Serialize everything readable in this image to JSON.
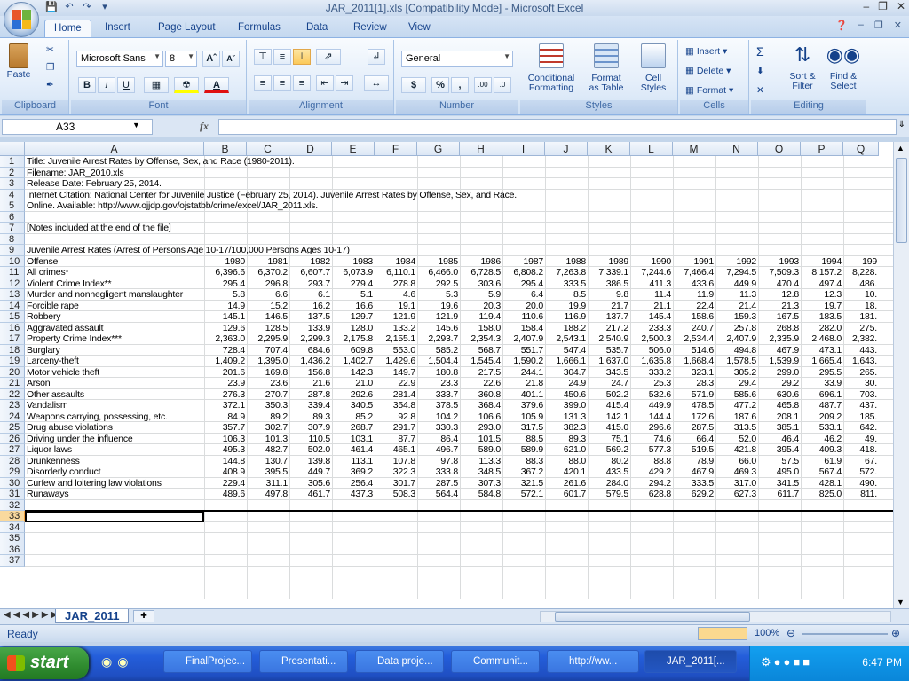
{
  "window": {
    "title": "JAR_2011[1].xls  [Compatibility Mode] - Microsoft Excel"
  },
  "ribbon_tabs": [
    "Home",
    "Insert",
    "Page Layout",
    "Formulas",
    "Data",
    "Review",
    "View"
  ],
  "ribbon": {
    "clipboard": {
      "label": "Clipboard",
      "paste": "Paste"
    },
    "font": {
      "label": "Font",
      "name": "Microsoft Sans",
      "size": "8"
    },
    "alignment": {
      "label": "Alignment"
    },
    "number": {
      "label": "Number",
      "format": "General"
    },
    "styles": {
      "label": "Styles",
      "conditional": "Conditional",
      "conditional2": "Formatting",
      "format_table": "Format",
      "format_table2": "as Table",
      "cell_styles": "Cell",
      "cell_styles2": "Styles"
    },
    "cells": {
      "label": "Cells",
      "insert": "Insert",
      "delete": "Delete",
      "format": "Format"
    },
    "editing": {
      "label": "Editing",
      "sort": "Sort &",
      "sort2": "Filter",
      "find": "Find &",
      "find2": "Select"
    }
  },
  "formula_bar": {
    "name_box": "A33",
    "fx": "fx",
    "value": ""
  },
  "columns": [
    "A",
    "B",
    "C",
    "D",
    "E",
    "F",
    "G",
    "H",
    "I",
    "J",
    "K",
    "L",
    "M",
    "N",
    "O",
    "P",
    "Q"
  ],
  "rows": [
    [
      "Title: Juvenile Arrest Rates by Offense, Sex, and Race (1980-2011)."
    ],
    [
      "Filename: JAR_2010.xls"
    ],
    [
      "Release Date: February 25, 2014."
    ],
    [
      "Internet Citation: National Center for Juvenile Justice (February 25, 2014). Juvenile Arrest Rates by Offense, Sex, and Race."
    ],
    [
      "  Online. Available: http://www.ojjdp.gov/ojstatbb/crime/excel/JAR_2011.xls."
    ],
    [
      ""
    ],
    [
      "[Notes included at the end of the file]"
    ],
    [
      ""
    ],
    [
      "Juvenile Arrest Rates (Arrest of Persons Age 10-17/100,000 Persons Ages 10-17)"
    ],
    [
      "Offense",
      "1980",
      "1981",
      "1982",
      "1983",
      "1984",
      "1985",
      "1986",
      "1987",
      "1988",
      "1989",
      "1990",
      "1991",
      "1992",
      "1993",
      "1994",
      "199"
    ],
    [
      "All crimes*",
      "6,396.6",
      "6,370.2",
      "6,607.7",
      "6,073.9",
      "6,110.1",
      "6,466.0",
      "6,728.5",
      "6,808.2",
      "7,263.8",
      "7,339.1",
      "7,244.6",
      "7,466.4",
      "7,294.5",
      "7,509.3",
      "8,157.2",
      "8,228."
    ],
    [
      "Violent Crime Index**",
      "295.4",
      "296.8",
      "293.7",
      "279.4",
      "278.8",
      "292.5",
      "303.6",
      "295.4",
      "333.5",
      "386.5",
      "411.3",
      "433.6",
      "449.9",
      "470.4",
      "497.4",
      "486."
    ],
    [
      "Murder and nonnegligent manslaughter",
      "5.8",
      "6.6",
      "6.1",
      "5.1",
      "4.6",
      "5.3",
      "5.9",
      "6.4",
      "8.5",
      "9.8",
      "11.4",
      "11.9",
      "11.3",
      "12.8",
      "12.3",
      "10."
    ],
    [
      "Forcible rape",
      "14.9",
      "15.2",
      "16.2",
      "16.6",
      "19.1",
      "19.6",
      "20.3",
      "20.0",
      "19.9",
      "21.7",
      "21.1",
      "22.4",
      "21.4",
      "21.3",
      "19.7",
      "18."
    ],
    [
      "Robbery",
      "145.1",
      "146.5",
      "137.5",
      "129.7",
      "121.9",
      "121.9",
      "119.4",
      "110.6",
      "116.9",
      "137.7",
      "145.4",
      "158.6",
      "159.3",
      "167.5",
      "183.5",
      "181."
    ],
    [
      "Aggravated assault",
      "129.6",
      "128.5",
      "133.9",
      "128.0",
      "133.2",
      "145.6",
      "158.0",
      "158.4",
      "188.2",
      "217.2",
      "233.3",
      "240.7",
      "257.8",
      "268.8",
      "282.0",
      "275."
    ],
    [
      "Property Crime Index***",
      "2,363.0",
      "2,295.9",
      "2,299.3",
      "2,175.8",
      "2,155.1",
      "2,293.7",
      "2,354.3",
      "2,407.9",
      "2,543.1",
      "2,540.9",
      "2,500.3",
      "2,534.4",
      "2,407.9",
      "2,335.9",
      "2,468.0",
      "2,382."
    ],
    [
      "Burglary",
      "728.4",
      "707.4",
      "684.6",
      "609.8",
      "553.0",
      "585.2",
      "568.7",
      "551.7",
      "547.4",
      "535.7",
      "506.0",
      "514.6",
      "494.8",
      "467.9",
      "473.1",
      "443."
    ],
    [
      "Larceny-theft",
      "1,409.2",
      "1,395.0",
      "1,436.2",
      "1,402.7",
      "1,429.6",
      "1,504.4",
      "1,545.4",
      "1,590.2",
      "1,666.1",
      "1,637.0",
      "1,635.8",
      "1,668.4",
      "1,578.5",
      "1,539.9",
      "1,665.4",
      "1,643."
    ],
    [
      "Motor vehicle theft",
      "201.6",
      "169.8",
      "156.8",
      "142.3",
      "149.7",
      "180.8",
      "217.5",
      "244.1",
      "304.7",
      "343.5",
      "333.2",
      "323.1",
      "305.2",
      "299.0",
      "295.5",
      "265."
    ],
    [
      "Arson",
      "23.9",
      "23.6",
      "21.6",
      "21.0",
      "22.9",
      "23.3",
      "22.6",
      "21.8",
      "24.9",
      "24.7",
      "25.3",
      "28.3",
      "29.4",
      "29.2",
      "33.9",
      "30."
    ],
    [
      "Other assaults",
      "276.3",
      "270.7",
      "287.8",
      "292.6",
      "281.4",
      "333.7",
      "360.8",
      "401.1",
      "450.6",
      "502.2",
      "532.6",
      "571.9",
      "585.6",
      "630.6",
      "696.1",
      "703."
    ],
    [
      "Vandalism",
      "372.1",
      "350.3",
      "339.4",
      "340.5",
      "354.8",
      "378.5",
      "368.4",
      "379.6",
      "399.0",
      "415.4",
      "449.9",
      "478.5",
      "477.2",
      "465.8",
      "487.7",
      "437."
    ],
    [
      "Weapons carrying, possessing, etc.",
      "84.9",
      "89.2",
      "89.3",
      "85.2",
      "92.8",
      "104.2",
      "106.6",
      "105.9",
      "131.3",
      "142.1",
      "144.4",
      "172.6",
      "187.6",
      "208.1",
      "209.2",
      "185."
    ],
    [
      "Drug abuse violations",
      "357.7",
      "302.7",
      "307.9",
      "268.7",
      "291.7",
      "330.3",
      "293.0",
      "317.5",
      "382.3",
      "415.0",
      "296.6",
      "287.5",
      "313.5",
      "385.1",
      "533.1",
      "642."
    ],
    [
      "Driving under the influence",
      "106.3",
      "101.3",
      "110.5",
      "103.1",
      "87.7",
      "86.4",
      "101.5",
      "88.5",
      "89.3",
      "75.1",
      "74.6",
      "66.4",
      "52.0",
      "46.4",
      "46.2",
      "49."
    ],
    [
      "Liquor laws",
      "495.3",
      "482.7",
      "502.0",
      "461.4",
      "465.1",
      "496.7",
      "589.0",
      "589.9",
      "621.0",
      "569.2",
      "577.3",
      "519.5",
      "421.8",
      "395.4",
      "409.3",
      "418."
    ],
    [
      "Drunkenness",
      "144.8",
      "130.7",
      "139.8",
      "113.1",
      "107.8",
      "97.8",
      "113.3",
      "88.3",
      "88.0",
      "80.2",
      "88.8",
      "78.9",
      "66.0",
      "57.5",
      "61.9",
      "67."
    ],
    [
      "Disorderly conduct",
      "408.9",
      "395.5",
      "449.7",
      "369.2",
      "322.3",
      "333.8",
      "348.5",
      "367.2",
      "420.1",
      "433.5",
      "429.2",
      "467.9",
      "469.3",
      "495.0",
      "567.4",
      "572."
    ],
    [
      "Curfew and loitering law violations",
      "229.4",
      "311.1",
      "305.6",
      "256.4",
      "301.7",
      "287.5",
      "307.3",
      "321.5",
      "261.6",
      "284.0",
      "294.2",
      "333.5",
      "317.0",
      "341.5",
      "428.1",
      "490."
    ],
    [
      "Runaways",
      "489.6",
      "497.8",
      "461.7",
      "437.3",
      "508.3",
      "564.4",
      "584.8",
      "572.1",
      "601.7",
      "579.5",
      "628.8",
      "629.2",
      "627.3",
      "611.7",
      "825.0",
      "811."
    ],
    [
      ""
    ],
    [
      ""
    ],
    [
      ""
    ],
    [
      ""
    ],
    [
      ""
    ],
    [
      ""
    ]
  ],
  "sheet_tab": "JAR_2011",
  "status": {
    "ready": "Ready",
    "zoom": "100%"
  },
  "taskbar": {
    "start": "start",
    "items": [
      "FinalProjec...",
      "Presentati...",
      "Data proje...",
      "Communit...",
      "http://ww...",
      "JAR_2011[..."
    ],
    "clock": "6:47 PM"
  }
}
